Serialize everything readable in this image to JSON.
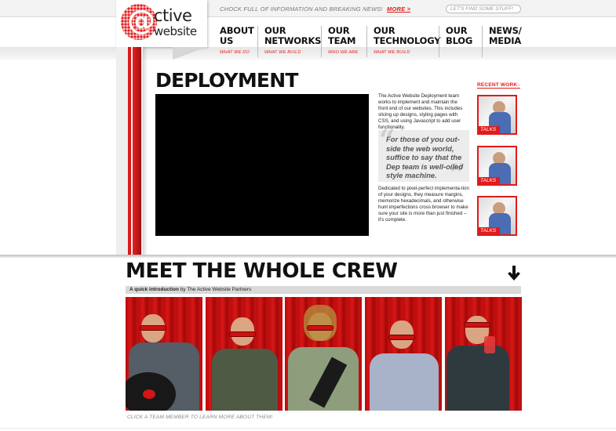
{
  "header": {
    "tagline": "CHOCK FULL OF INFORMATION AND BREAKING NEWS!",
    "more_link": "MORE >",
    "search_placeholder": "LET'S FIND SOME STUFF!"
  },
  "logo": {
    "at_symbol": "@",
    "word1": "ctive",
    "word2": "website"
  },
  "nav": {
    "items": [
      {
        "title_line1": "ABOUT",
        "title_line2": "US",
        "subtitle": "WHAT WE DO"
      },
      {
        "title_line1": "OUR",
        "title_line2": "NETWORKS",
        "subtitle": "WHAT WE BUILD"
      },
      {
        "title_line1": "OUR",
        "title_line2": "TEAM",
        "subtitle": "WHO WE ARE"
      },
      {
        "title_line1": "OUR",
        "title_line2": "TECHNOLOGY",
        "subtitle": "WHAT WE BUILD"
      },
      {
        "title_line1": "OUR",
        "title_line2": "BLOG",
        "subtitle": ""
      },
      {
        "title_line1": "NEWS/",
        "title_line2": "MEDIA",
        "subtitle": ""
      }
    ]
  },
  "main": {
    "title": "DEPLOYMENT",
    "intro": "The Active Website Deployment team works to implement and maintain the front end of our websites.  This includes slicing up designs, styling pages with CSS, and using Javascript to add user functionality.",
    "quote": "For those of you out-side the web world, suffice to say that the Dep team is well-oiled style machine.",
    "body": "Dedicated to pixel-perfect implementa-tion of your designs, they measure margins, memorize hexadecimals, and otherwise hunt imperfections cross browser to make sure your site is more than just finished – it's complete."
  },
  "recent_work": {
    "label": "RECENT WORK",
    "items": [
      {
        "tag": "TALKS"
      },
      {
        "tag": "TALKS"
      },
      {
        "tag": "TALKS"
      }
    ]
  },
  "crew": {
    "title": "MEET THE WHOLE CREW",
    "bar_bold": "A quick introduction",
    "bar_rest": " by The Active Website Partners",
    "caption": "CLICK A TEAM MEMBER TO LEARN MORE ABOUT THEM!",
    "members": [
      {
        "shirt_color": "#555d66"
      },
      {
        "shirt_color": "#4f5a45"
      },
      {
        "shirt_color": "#8e9e7c"
      },
      {
        "shirt_color": "#a8b2c8"
      },
      {
        "shirt_color": "#2f3a3f"
      }
    ]
  },
  "colors": {
    "accent": "#e01b1b",
    "text": "#111111"
  }
}
